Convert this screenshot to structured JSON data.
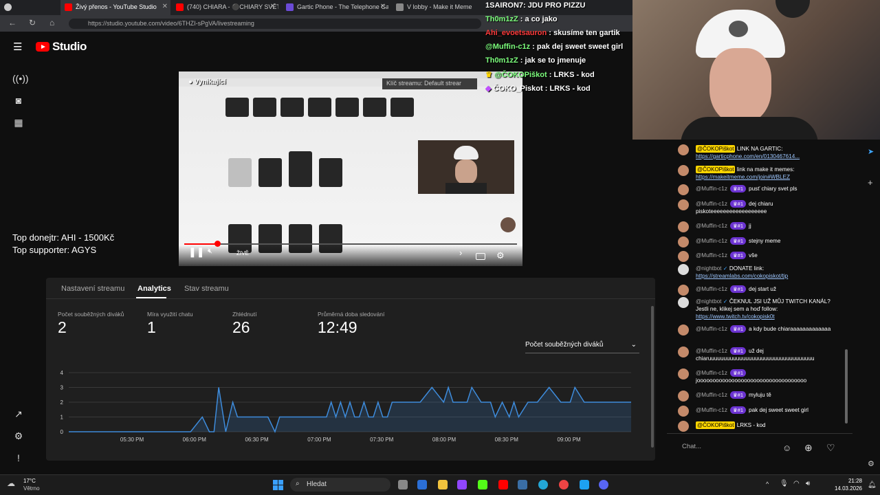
{
  "browser": {
    "tabs": [
      {
        "title": "Živý přenos - YouTube Studio",
        "color": "#ff0000"
      },
      {
        "title": "(740) CHIARA - ⚫CHIARY SVĚT 4",
        "color": "#ff0000"
      },
      {
        "title": "Gartic Phone - The Telephone Ga",
        "color": "#6b4bd6"
      },
      {
        "title": "V lobby - Make it Meme",
        "color": "#444"
      }
    ],
    "url": "https://studio.youtube.com/video/6THZI-sPgVA/livestreaming"
  },
  "studio": {
    "logo": "Studio"
  },
  "overlay_chat": [
    {
      "user": "1SAIRON7",
      "text": "JDU PRO PIZZU",
      "color": "#ffffff"
    },
    {
      "user": "Th0m1zZ",
      "text": "a co jako",
      "color": "#7dff7d"
    },
    {
      "user": "Ahi_evoetsauron",
      "text": "skusíme ten gartik",
      "color": "#ff3b3b"
    },
    {
      "user": "@Muffin-c1z",
      "text": "pak dej sweet sweet girl",
      "color": "#7dff7d"
    },
    {
      "user": "Th0m1zZ",
      "text": "jak se to jmenuje",
      "color": "#7dff7d"
    },
    {
      "user": "@ČOKOPiškot",
      "text": "LRKS - kod",
      "color": "#7dff7d"
    },
    {
      "user": "ČOKO_Piskot",
      "text": "LRKS - kod",
      "color": "#ffffff"
    }
  ],
  "stream_overlay": {
    "top_donor": "Top donejtr: AHI - 1500Kč",
    "top_supporter": "Top supporter: AGYS"
  },
  "player": {
    "title": "Vynikající",
    "stream_key": "Klíč streamu: Default strear",
    "live_label": "ŽIVĚ"
  },
  "analytics": {
    "tabs": [
      "Nastavení streamu",
      "Analytics",
      "Stav streamu"
    ],
    "metrics": [
      {
        "label": "Počet souběžných diváků",
        "value": "2"
      },
      {
        "label": "Míra využití chatu",
        "value": "1"
      },
      {
        "label": "Zhlédnutí",
        "value": "26"
      },
      {
        "label": "Průměrná doba sledování",
        "value": "12:49"
      }
    ],
    "dropdown": "Počet souběžných diváků"
  },
  "chart_data": {
    "type": "area",
    "title": "",
    "xlabel": "",
    "ylabel": "",
    "ylim": [
      0,
      4
    ],
    "yticks": [
      0,
      1,
      2,
      3,
      4
    ],
    "xticks": [
      "05:30 PM",
      "06:00 PM",
      "06:30 PM",
      "07:00 PM",
      "07:30 PM",
      "08:00 PM",
      "08:30 PM",
      "09:00 PM"
    ],
    "series": [
      {
        "x": [
          0,
          52,
          57,
          60,
          62,
          64,
          67,
          70,
          72,
          74,
          85,
          88,
          90,
          110,
          112,
          114,
          116,
          118,
          120,
          122,
          124,
          126,
          128,
          130,
          132,
          134,
          136,
          138,
          140,
          142,
          150,
          155,
          160,
          162,
          164,
          166,
          170,
          172,
          176,
          180,
          182,
          185,
          188,
          190,
          192,
          196,
          200,
          205,
          210,
          214,
          216,
          220,
          240
        ],
        "values": [
          0,
          0,
          1,
          0,
          0,
          3,
          0,
          2,
          1,
          1,
          1,
          0,
          1,
          1,
          2,
          1,
          2,
          1,
          2,
          1,
          1,
          2,
          1,
          1,
          2,
          1,
          1,
          2,
          2,
          2,
          2,
          3,
          2,
          3,
          2,
          2,
          2,
          3,
          2,
          2,
          1,
          2,
          1,
          2,
          1,
          2,
          2,
          3,
          2,
          2,
          3,
          2,
          2
        ]
      }
    ]
  },
  "live_chat": [
    {
      "user": "@ČOKOPiškot",
      "pill": true,
      "text": "LINK NA GARTIC:",
      "link": "https://garticphone.com/en/0130467614..."
    },
    {
      "user": "@ČOKOPiškot",
      "pill": true,
      "text": "link na make it memes:",
      "link": "https://makeitmeme.com/join#WBLEZ"
    },
    {
      "user": "@Muffin-c1z",
      "badge": "#1",
      "text": "pusť chiary svet pls"
    },
    {
      "user": "@Muffin-c1z",
      "badge": "#1",
      "text": "dej chiaru piskoteeeeeeeeeeeeeeeeee"
    },
    {
      "user": "@Muffin-c1z",
      "badge": "#1",
      "text": "jj"
    },
    {
      "user": "@Muffin-c1z",
      "badge": "#1",
      "text": "stejny meme"
    },
    {
      "user": "@Muffin-c1z",
      "badge": "#1",
      "text": "vše"
    },
    {
      "user": "@nightbot",
      "bot": true,
      "text": "DONATE link:",
      "link": "https://streamlabs.com/cokopiskot/tip"
    },
    {
      "user": "@Muffin-c1z",
      "badge": "#1",
      "text": "dej start už"
    },
    {
      "user": "@nightbot",
      "bot": true,
      "text": "ČEKNUL JSI UŽ MŮJ TWITCH KANÁL? Jestli ne, klikej sem a hoď follow:",
      "link": "https://www.twitch.tv/cokopisk0t"
    },
    {
      "user": "@Muffin-c1z",
      "badge": "#1",
      "text": "a kdy bude chiaraaaaaaaaaaaaa"
    },
    {
      "user": "@Muffin-c1z",
      "badge": "#1",
      "text": "už dej chiaruuuuuuuuuuuuuuuuuuuuuuuuuuuuuuuuuu"
    },
    {
      "user": "@Muffin-c1z",
      "badge": "#1",
      "text": "jooooooooooooooooooooooooooooooooooo"
    },
    {
      "user": "@Muffin-c1z",
      "badge": "#1",
      "text": "myluju tě"
    },
    {
      "user": "@Muffin-c1z",
      "badge": "#1",
      "text": "pak dej sweet sweet girl"
    },
    {
      "user": "@ČOKOPiškot",
      "pill": true,
      "text": "LRKS - kod"
    }
  ],
  "chat_input": {
    "placeholder": "Chat..."
  },
  "taskbar": {
    "weather_temp": "17°C",
    "weather_text": "Větrno",
    "search": "Hledat",
    "time": "21:28",
    "date": "14.03.2026"
  }
}
